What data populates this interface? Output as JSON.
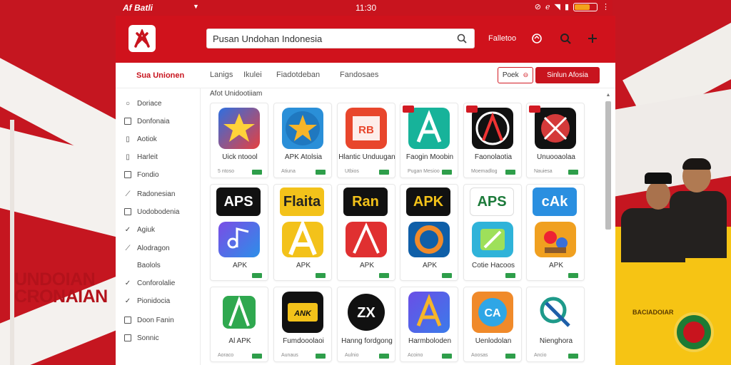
{
  "status_bar": {
    "carrier": "Af Batli",
    "time": "11:30",
    "battery_level": 0.7
  },
  "header": {
    "search_value": "Pusan Undohan Indonesia",
    "link": "Falletoo"
  },
  "subnav": {
    "brand": "Sua Unionen",
    "tabs": [
      "Lanigs",
      "Ikulei",
      "Fiadotdeban",
      "Fandosaes"
    ],
    "outline_button": "Poek",
    "primary_button": "Sinlun Afosia"
  },
  "sidebar": {
    "items": [
      {
        "label": "Doriace",
        "icon": "circle-icon"
      },
      {
        "label": "Donfonaia",
        "icon": "square-icon"
      },
      {
        "label": "Aotiok",
        "icon": "doc-icon"
      },
      {
        "label": "Harleit",
        "icon": "doc-icon"
      },
      {
        "label": "Fondio",
        "icon": "square-icon"
      },
      {
        "label": "Radonesian",
        "icon": "leaf-icon"
      },
      {
        "label": "Uodobodenia",
        "icon": "square-icon"
      },
      {
        "label": "Agiuk",
        "icon": "check-icon"
      },
      {
        "label": "Alodragon",
        "icon": "leaf-icon"
      },
      {
        "label": "Baolols",
        "icon": ""
      },
      {
        "label": "Conforolalie",
        "icon": "check-icon"
      },
      {
        "label": "Pionidocia",
        "icon": "check-icon"
      },
      {
        "label": "Doon Fanin",
        "icon": "square-icon"
      },
      {
        "label": "Sonnic",
        "icon": "square-icon"
      }
    ]
  },
  "section_label": "Afot Unidootiiam",
  "apps": [
    {
      "name": "Uick ntoool",
      "meta": "5 ntoso",
      "icon": "star-icon"
    },
    {
      "name": "APK Atolsia",
      "meta": "Atiuna",
      "icon": "star-icon"
    },
    {
      "name": "Hlantic Unduugan",
      "meta": "Utbios",
      "icon": "bank-icon"
    },
    {
      "name": "Faogin Moobin",
      "meta": "Pugan Mesioo",
      "icon": "letter-a-icon"
    },
    {
      "name": "Faonolaotia",
      "meta": "Moemadlog",
      "icon": "letter-a-icon"
    },
    {
      "name": "Unuooaolaa",
      "meta": "Nauiesa",
      "icon": "bug-icon"
    },
    {
      "name": "APK",
      "meta": "",
      "icon": "music-icon",
      "wordmark": "APS"
    },
    {
      "name": "APK",
      "meta": "",
      "icon": "letter-a-icon",
      "wordmark": "Flaita"
    },
    {
      "name": "APK",
      "meta": "",
      "icon": "letter-a-icon",
      "wordmark": "Ran"
    },
    {
      "name": "APK",
      "meta": "",
      "icon": "ring-icon",
      "wordmark": "APK"
    },
    {
      "name": "Cotie Hacoos",
      "meta": "",
      "icon": "folder-icon",
      "wordmark": "APS"
    },
    {
      "name": "APK",
      "meta": "",
      "icon": "tools-icon",
      "wordmark": "cAk"
    },
    {
      "name": "Al APK",
      "meta": "Aoraco",
      "icon": "letter-a-icon"
    },
    {
      "name": "Fumdooolaoi",
      "meta": "Aunaus",
      "icon": "ticket-icon"
    },
    {
      "name": "Hanng fordgong",
      "meta": "Aulnio",
      "icon": "letter-x-icon"
    },
    {
      "name": "Harmboloden",
      "meta": "Acoino",
      "icon": "letter-a-icon"
    },
    {
      "name": "Uenlodolan",
      "meta": "Aoosas",
      "icon": "ca-icon"
    },
    {
      "name": "Nienghora",
      "meta": "Ancio",
      "icon": "link-icon"
    }
  ],
  "promo": {
    "line1": "UNDOIAN",
    "line2": "CRONAIAN",
    "sub": "BACIADOIAR"
  },
  "colors": {
    "brand_red": "#d0121c",
    "accent_green": "#2e9e4a",
    "promo_yellow": "#f6c414"
  }
}
